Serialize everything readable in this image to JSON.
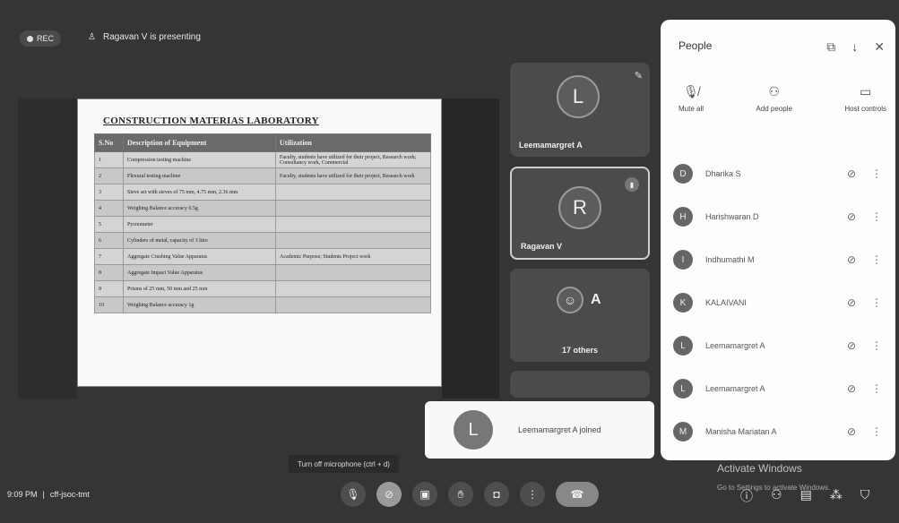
{
  "topbar": {
    "rec": "REC",
    "presenting": "Ragavan V is presenting"
  },
  "slide": {
    "title": "CONSTRUCTION MATERIAS LABORATORY",
    "headers": [
      "S.No",
      "Description of Equipment",
      "Utilization"
    ],
    "rows": [
      {
        "no": "1",
        "desc": "Compression testing machine",
        "util": "Faculty, students have utilized for their project, Research work; Consultancy work, Commercial"
      },
      {
        "no": "2",
        "desc": "Flexural testing machine",
        "util": "Faculty, students have utilized for their project, Research work"
      },
      {
        "no": "3",
        "desc": "Sieve set with sieves of 75 mm, 4.75 mm, 2.36 mm",
        "util": ""
      },
      {
        "no": "4",
        "desc": "Weighing Balance accuracy 0.5g",
        "util": ""
      },
      {
        "no": "5",
        "desc": "Pycnometer",
        "util": ""
      },
      {
        "no": "6",
        "desc": "Cylinders of metal, capacity of 3 litre",
        "util": ""
      },
      {
        "no": "7",
        "desc": "Aggregate Crushing Value Apparatus",
        "util": "Academic Purpose; Students Project work"
      },
      {
        "no": "8",
        "desc": "Aggregate Impact Value Apparatus",
        "util": ""
      },
      {
        "no": "9",
        "desc": "Prisms of 25 mm, 50 mm and 25 mm",
        "util": ""
      },
      {
        "no": "10",
        "desc": "Weighing Balance accuracy 1g",
        "util": ""
      }
    ]
  },
  "tiles": [
    {
      "initial": "L",
      "name": "Leemamargret A"
    },
    {
      "initial": "R",
      "name": "Ragavan V"
    },
    {
      "initial": "A",
      "name": "17 others"
    }
  ],
  "panel": {
    "title": "People",
    "actions": [
      "Mute all",
      "Add people",
      "Host controls"
    ],
    "participants": [
      {
        "initial": "D",
        "name": "Dharika S"
      },
      {
        "initial": "H",
        "name": "Harishwaran D"
      },
      {
        "initial": "I",
        "name": "Indhumathi M"
      },
      {
        "initial": "K",
        "name": "KALAIVANI"
      },
      {
        "initial": "L",
        "name": "Leemamargret A"
      },
      {
        "initial": "L",
        "name": "Leemamargret A"
      },
      {
        "initial": "M",
        "name": "Manisha Mariatan A"
      }
    ]
  },
  "toast": {
    "initial": "L",
    "message": "Leemamargret A joined"
  },
  "tooltip": "Turn off microphone (ctrl + d)",
  "bottombar": {
    "time": "9:09 PM",
    "separator": "|",
    "code": "cff-jsoc-tmt"
  },
  "watermark": {
    "line1": "Activate Windows",
    "line2": "Go to Settings to activate Windows."
  }
}
